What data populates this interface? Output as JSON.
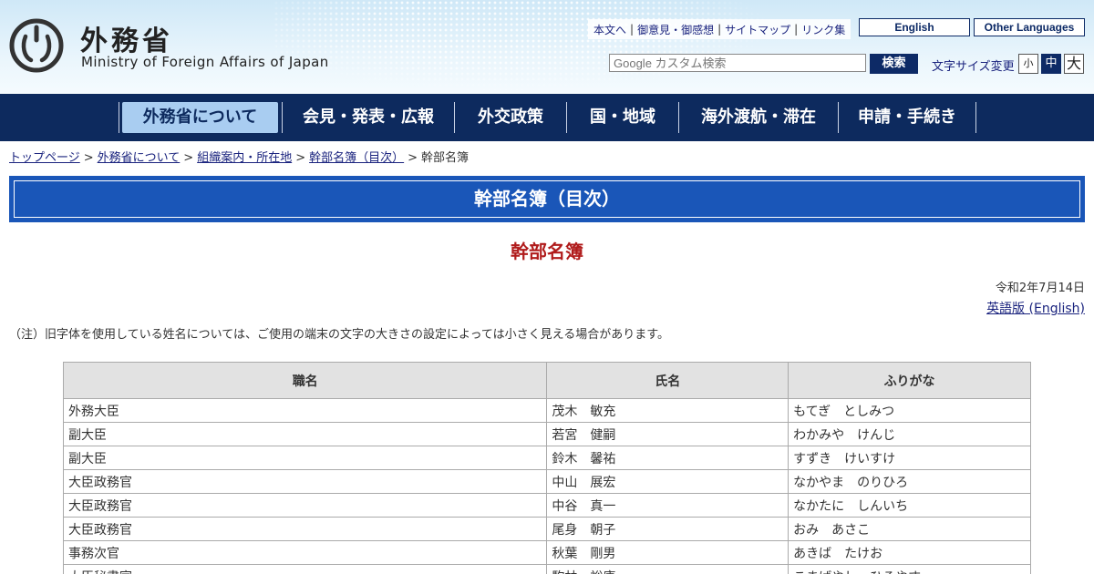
{
  "header": {
    "logo_jp": "外務省",
    "logo_en": "Ministry of Foreign Affairs of Japan",
    "util_links": [
      "本文へ",
      "御意見・御感想",
      "サイトマップ",
      "リンク集"
    ],
    "english_button": "English",
    "other_languages_button": "Other Languages",
    "search_placeholder": "Google カスタム検索",
    "search_button": "検索",
    "font_size_label": "文字サイズ変更",
    "font_sizes": [
      "小",
      "中",
      "大"
    ],
    "font_size_selected": "中"
  },
  "nav": {
    "items": [
      "外務省について",
      "会見・発表・広報",
      "外交政策",
      "国・地域",
      "海外渡航・滞在",
      "申請・手続き"
    ],
    "active": "外務省について"
  },
  "breadcrumb": {
    "links": [
      "トップページ",
      "外務省について",
      "組織案内・所在地",
      "幹部名簿（目次）"
    ],
    "current": "幹部名簿",
    "separator": ">"
  },
  "page": {
    "title": "幹部名簿（目次）",
    "subtitle": "幹部名簿",
    "date": "令和2年7月14日",
    "english_link": "英語版 (English)",
    "note": "（注）旧字体を使用している姓名については、ご使用の端末の文字の大きさの設定によっては小さく見える場合があります。"
  },
  "table": {
    "headers": [
      "職名",
      "氏名",
      "ふりがな"
    ],
    "rows": [
      [
        "外務大臣",
        "茂木　敏充",
        "もてぎ　としみつ"
      ],
      [
        "副大臣",
        "若宮　健嗣",
        "わかみや　けんじ"
      ],
      [
        "副大臣",
        "鈴木　馨祐",
        "すずき　けいすけ"
      ],
      [
        "大臣政務官",
        "中山　展宏",
        "なかやま　のりひろ"
      ],
      [
        "大臣政務官",
        "中谷　真一",
        "なかたに　しんいち"
      ],
      [
        "大臣政務官",
        "尾身　朝子",
        "おみ　あさこ"
      ],
      [
        "事務次官",
        "秋葉　剛男",
        "あきば　たけお"
      ],
      [
        "大臣秘書官",
        "駒林　裕康",
        "こまばやし　ひろやす"
      ]
    ]
  },
  "colors": {
    "nav_bg": "#0d2a5e",
    "title_bg": "#1a56b8",
    "subtitle": "#b01b1b",
    "nav_active_bg": "#a9cdf1"
  }
}
